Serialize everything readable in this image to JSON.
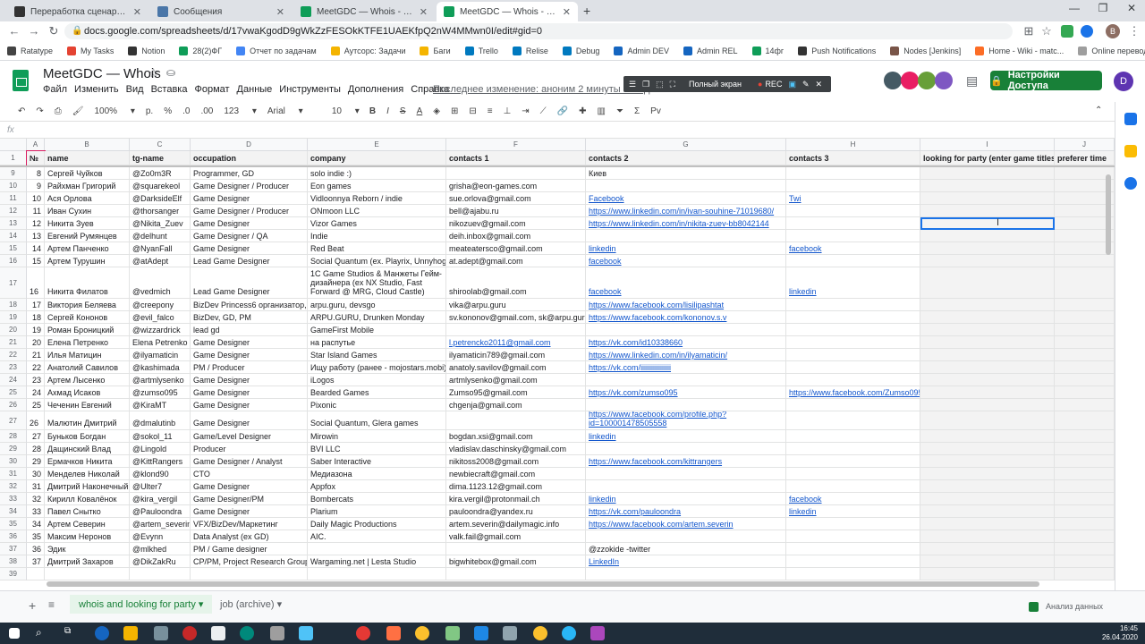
{
  "browser": {
    "tabs": [
      {
        "title": "Переработка сценария пещер"
      },
      {
        "title": "Сообщения"
      },
      {
        "title": "MeetGDC — Whois - Google Ta"
      },
      {
        "title": "MeetGDC — Whois - Google Ta"
      }
    ],
    "url": "docs.google.com/spreadsheets/d/17vwaKgodD9gWkZzFESOkKTFE1UAEKfpQ2nW4MMwn0I/edit#gid=0",
    "bookmarks": [
      "Ratatype",
      "My Tasks",
      "Notion",
      "28(2)ФГ",
      "Отчет по задачам",
      "Аутсорс: Задачи",
      "Баги",
      "Trello",
      "Relise",
      "Debug",
      "Admin DEV",
      "Admin REL",
      "14фг",
      "Push Notifications",
      "Nodes [Jenkins]",
      "Home - Wiki - matc...",
      "Online перевод (с..."
    ]
  },
  "sheet": {
    "title": "MeetGDC — Whois",
    "menus": [
      "Файл",
      "Изменить",
      "Вид",
      "Вставка",
      "Формат",
      "Данные",
      "Инструменты",
      "Дополнения",
      "Справка"
    ],
    "last_edit": "Последнее изменение: аноним 2 минуты назад",
    "share_label": "Настройки Доступа",
    "user_initial": "D",
    "rec_bar": {
      "fullscreen": "Полный экран",
      "rec": "REC"
    },
    "toolbar": {
      "zoom": "100%",
      "currency": "р.",
      "percent": "%",
      "dec1": ".0",
      "dec2": ".00",
      "format": "123",
      "font": "Arial",
      "size": "10",
      "input_tools": "Рv"
    },
    "fx": "fx"
  },
  "columns": [
    "A",
    "B",
    "C",
    "D",
    "E",
    "F",
    "G",
    "H",
    "I",
    "J"
  ],
  "header": [
    "№",
    "name",
    "tg-name",
    "occupation",
    "company",
    "contacts 1",
    "contacts 2",
    "contacts 3",
    "looking for party (enter game titles)",
    "preferer time"
  ],
  "rows": [
    {
      "r": "9",
      "c": [
        "8",
        "Сергей Чуйков",
        "@Zo0m3R",
        "Programmer, GD",
        "solo indie :)",
        "",
        "Киев",
        "",
        "",
        ""
      ]
    },
    {
      "r": "10",
      "c": [
        "9",
        "Райхман Григорий",
        "@squarekeol",
        "Game Designer / Producer",
        "Eon games",
        "grisha@eon-games.com",
        "",
        "",
        "",
        ""
      ]
    },
    {
      "r": "11",
      "c": [
        "10",
        "Ася Орлова",
        "@DarksideElf",
        "Game Designer",
        "Vidloonnya Reborn / indie",
        "sue.orlova@gmail.com",
        "Facebook",
        "Twi",
        "",
        ""
      ]
    },
    {
      "r": "12",
      "c": [
        "11",
        "Иван Сухин",
        "@thorsanger",
        "Game Designer / Producer",
        "ONmoon LLC",
        "bell@ajabu.ru",
        "https://www.linkedin.com/in/ivan-souhine-71019680/",
        "",
        "",
        ""
      ]
    },
    {
      "r": "13",
      "c": [
        "12",
        "Никита Зуев",
        "@Nikita_Zuev",
        "Game Designer",
        "Vizor Games",
        "nikozuev@gmail.com",
        "https://www.linkedin.com/in/nikita-zuev-bb8042144",
        "",
        "",
        ""
      ]
    },
    {
      "r": "14",
      "c": [
        "13",
        "Евгений Румянцев",
        "@delhunt",
        "Game Designer / QA",
        "Indie",
        "deih.inbox@gmail.com",
        "",
        "",
        "",
        ""
      ]
    },
    {
      "r": "15",
      "c": [
        "14",
        "Артем Панченко",
        "@NyanFall",
        "Game Designer",
        "Red Beat",
        "meateatersco@gmail.com",
        "linkedin",
        "facebook",
        "",
        ""
      ]
    },
    {
      "r": "16",
      "c": [
        "15",
        "Артем Турушин",
        "@atAdept",
        "Lead Game Designer",
        "Social Quantum (ex. Playrix, Unnyhog)",
        "at.adept@gmail.com",
        "facebook",
        "",
        "",
        ""
      ]
    },
    {
      "r": "17",
      "c": [
        "16",
        "Никита Филатов",
        "@vedmich",
        "Lead Game Designer",
        "1C Game Studios & Манжеты Гейм-дизайнера (ex NX Studio, Fast Forward @ MRG, Cloud Castle)",
        "shiroolab@gmail.com",
        "facebook",
        "linkedin",
        "",
        ""
      ]
    },
    {
      "r": "18",
      "c": [
        "17",
        "Виктория Беляева",
        "@creepony",
        "BizDev Princess6 организатор, массовик-затейник на ЗП",
        "arpu.guru, devsgo",
        "vika@arpu.guru",
        "https://www.facebook.com/lisilipashtat",
        "",
        "",
        ""
      ]
    },
    {
      "r": "19",
      "c": [
        "18",
        "Сергей Кононов",
        "@evil_falco",
        "BizDev, GD, PM",
        "ARPU.GURU, Drunken Monday",
        "sv.kononov@gmail.com, sk@arpu.guru",
        "https://www.facebook.com/kononov.s.v",
        "",
        "",
        ""
      ]
    },
    {
      "r": "20",
      "c": [
        "19",
        "Роман Броницкий",
        "@wizzardrick",
        "lead gd",
        "GameFirst Mobile",
        "",
        "",
        "",
        "",
        ""
      ]
    },
    {
      "r": "21",
      "c": [
        "20",
        "Елена Петренко",
        "Elena Petrenko",
        "Game Designer",
        "на распутье",
        "l.petrencko2011@gmail.com",
        "https://vk.com/id10338660",
        "",
        "",
        ""
      ]
    },
    {
      "r": "22",
      "c": [
        "21",
        "Илья Матицин",
        "@ilyamaticin",
        "Game Designer",
        "Star Island Games",
        "ilyamaticin789@gmail.com",
        "https://www.linkedin.com/in/ilyamaticin/",
        "",
        "",
        ""
      ]
    },
    {
      "r": "23",
      "c": [
        "22",
        "Анатолий Савилов",
        "@kashimada",
        "PM / Producer",
        "Ищу работу (ранее - mojostars.mobi)",
        "anatoly.savilov@gmail.com",
        "https://vk.com/iiiiiiiiiiiiiiiii",
        "",
        "",
        ""
      ]
    },
    {
      "r": "24",
      "c": [
        "23",
        "Артем Лысенко",
        "@artmlysenko",
        "Game Designer",
        "iLogos",
        "artmlysenko@gmail.com",
        "",
        "",
        "",
        ""
      ]
    },
    {
      "r": "25",
      "c": [
        "24",
        "Ахмад Исаков",
        "@zumso095",
        "Game Designer",
        "Bearded Games",
        "Zumso95@gmail.com",
        "https://vk.com/zumso095",
        "https://www.facebook.com/Zumso095",
        "",
        ""
      ]
    },
    {
      "r": "26",
      "c": [
        "25",
        "Чеченин Евгений",
        "@KiraMT",
        "Game Designer",
        "Pixonic",
        "chgenja@gmail.com",
        "",
        "",
        "",
        ""
      ]
    },
    {
      "r": "27",
      "c": [
        "26",
        "Малютин Дмитрий",
        "@dmalutinb",
        "Game Designer",
        "Social Quantum, Glera games",
        "",
        "https://www.facebook.com/profile.php?id=100001478505558",
        "",
        "",
        ""
      ]
    },
    {
      "r": "28",
      "c": [
        "27",
        "Буньков Богдан",
        "@sokol_11",
        "Game/Level Designer",
        "Mirowin",
        "bogdan.xsi@gmail.com",
        "linkedin",
        "",
        "",
        ""
      ]
    },
    {
      "r": "29",
      "c": [
        "28",
        "Дащинский Влад",
        "@Lingold",
        "Producer",
        "BVI LLC",
        "vladislav.daschinsky@gmail.com",
        "",
        "",
        "",
        ""
      ]
    },
    {
      "r": "30",
      "c": [
        "29",
        "Ермачков Никита",
        "@KittRangers",
        "Game Designer / Analyst",
        "Saber Interactive",
        "nikitoss2008@gmail.com",
        "https://www.facebook.com/kittrangers",
        "",
        "",
        ""
      ]
    },
    {
      "r": "31",
      "c": [
        "30",
        "Менделев Николай",
        "@klond90",
        "CTO",
        "Медиазона",
        "newbiecraft@gmail.com",
        "",
        "",
        "",
        ""
      ]
    },
    {
      "r": "32",
      "c": [
        "31",
        "Дмитрий Наконечный",
        "@Ulter7",
        "Game Designer",
        "Appfox",
        "dima.1123.12@gmail.com",
        "",
        "",
        "",
        ""
      ]
    },
    {
      "r": "33",
      "c": [
        "32",
        "Кирилл Ковалёнок",
        "@kira_vergil",
        "Game Designer/PM",
        "Bombercats",
        "kira.vergil@protonmail.ch",
        "linkedin",
        "facebook",
        "",
        ""
      ]
    },
    {
      "r": "34",
      "c": [
        "33",
        "Павел Снытко",
        "@Pauloondra",
        "Game Designer",
        "Plarium",
        "pauloondra@yandex.ru",
        "https://vk.com/pauloondra",
        "linkedin",
        "",
        ""
      ]
    },
    {
      "r": "35",
      "c": [
        "34",
        "Артем Северин",
        "@artem_severin",
        "VFX/BizDev/Маркетинг",
        "Daily Magic Productions",
        "artem.severin@dailymagic.info",
        "https://www.facebook.com/artem.severin",
        "",
        "",
        ""
      ]
    },
    {
      "r": "36",
      "c": [
        "35",
        "Максим Неронов",
        "@Evynn",
        "Data Analyst (ex GD)",
        "AIC.",
        "valk.fail@gmail.com",
        "",
        "",
        "",
        ""
      ]
    },
    {
      "r": "37",
      "c": [
        "36",
        "Эдик",
        "@mlkhed",
        "PM /  Game designer",
        "",
        "",
        "@zzokide -twitter",
        "",
        "",
        ""
      ]
    },
    {
      "r": "38",
      "c": [
        "37",
        "Дмитрий Захаров",
        "@DikZakRu",
        "CP/PM, Project Research Group",
        "Wargaming.net | Lesta Studio",
        "bigwhitebox@gmail.com",
        "LinkedIn",
        "",
        "",
        ""
      ]
    },
    {
      "r": "39",
      "c": [
        "",
        "",
        "",
        "",
        "",
        "",
        "",
        "",
        "",
        ""
      ]
    }
  ],
  "sheet_tabs": [
    "whois and looking for party",
    "job (archive)"
  ],
  "explore_label": "Анализ данных",
  "clock": {
    "time": "16:45",
    "date": "26.04.2020"
  }
}
